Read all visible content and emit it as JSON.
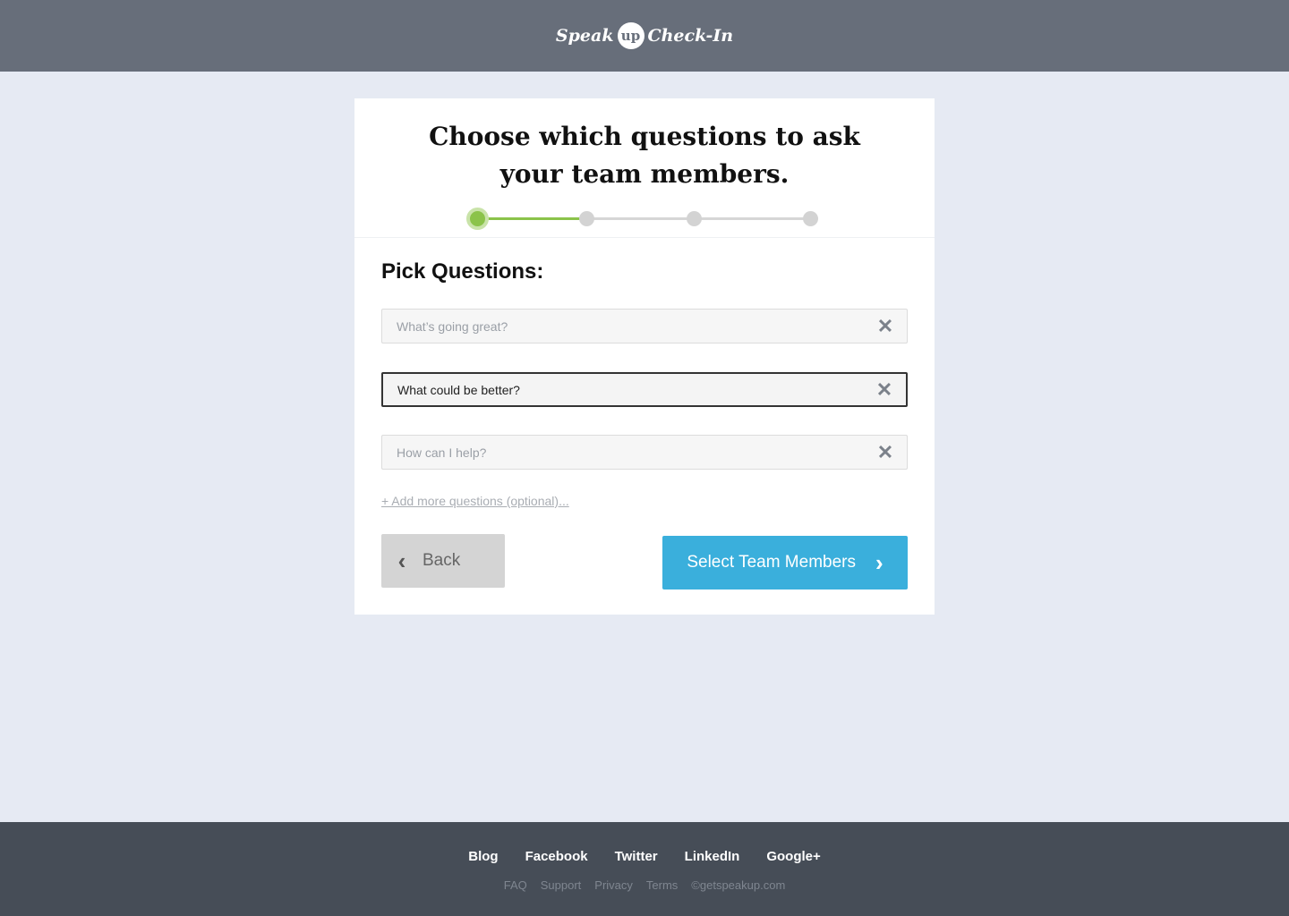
{
  "header": {
    "logo_left": "Speak",
    "logo_badge": "up",
    "logo_right": "Check-In"
  },
  "card": {
    "headline_line1": "Choose which questions to ask",
    "headline_line2": "your team members.",
    "stepper": {
      "total_steps": 4,
      "current_step": 1,
      "colors": {
        "done": "#8bc34a",
        "pending": "#d3d3d3"
      }
    },
    "section_title": "Pick Questions:",
    "questions": [
      {
        "value": "",
        "placeholder": "What’s going great?",
        "focused": false
      },
      {
        "value": "What could be better?",
        "placeholder": "",
        "focused": true
      },
      {
        "value": "",
        "placeholder": "How can I help?",
        "focused": false
      }
    ],
    "clear_icon": "close-icon",
    "add_more_link": "+ Add more questions (optional)...",
    "back_button": {
      "label": "Back",
      "icon": "chevron-left-icon"
    },
    "next_button": {
      "label": "Select Team Members",
      "icon": "chevron-right-icon",
      "color": "#3aafdc"
    }
  },
  "footer": {
    "links": [
      "Blog",
      "Facebook",
      "Twitter",
      "LinkedIn",
      "Google+"
    ],
    "sub_links": [
      "FAQ",
      "Support",
      "Privacy",
      "Terms",
      "©getspeakup.com"
    ]
  }
}
